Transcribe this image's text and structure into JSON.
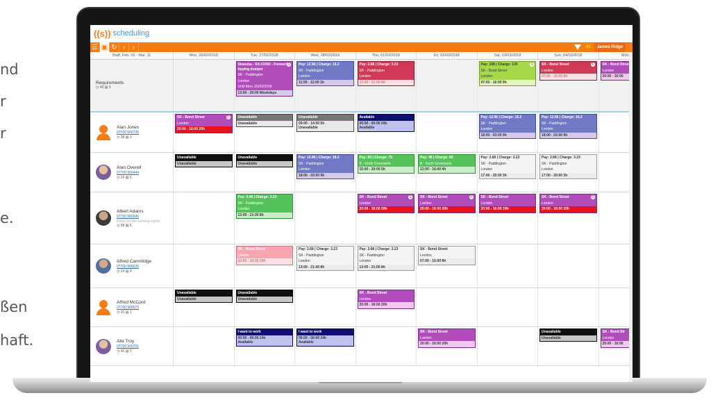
{
  "background_text": [
    "nd",
    "r",
    "r",
    "e.",
    "ßen",
    "haft."
  ],
  "app": {
    "logo_mark": "((s))",
    "logo_text": "scheduling"
  },
  "toolbar": {
    "buttons": [
      "☰",
      "💾",
      "↻",
      "‹",
      "›"
    ],
    "count": "-43",
    "user": "James Ridge"
  },
  "header": {
    "range_label": "Staff, Feb. 26 - Mar. 11",
    "days": [
      "Mon, 26/02/2018",
      "Tue, 27/02/2018",
      "Wed, 28/02/2018",
      "Thu, 01/03/2018",
      "Fri, 02/03/2018",
      "Sat, 03/03/2018",
      "Sun, 04/03/2018",
      "Mon, 05/"
    ]
  },
  "requirements": {
    "title": "Requirements",
    "stats": "◷ 46  ▤ 5",
    "cards": [
      {
        "day": 1,
        "color": "magenta",
        "head": "Skanska - SK-01992 - Forward tipping dumper",
        "body": "SK - Paddington\nLondon\nUntil Mon, 05/03/2018",
        "foot": "13:00 - 20:00 Weekdays",
        "sub": "lav",
        "badge": "1"
      },
      {
        "day": 2,
        "color": "blue",
        "head": "Pay: 12.96 | Charge: 16.2",
        "body": "SK - Paddington\nLondon",
        "foot": "11:00 - 12:00 1h",
        "sub": "lav"
      },
      {
        "day": 3,
        "color": "red",
        "head": "Pay: 2.68 | Charge: 3.23",
        "body": "SK - Paddington\nLondon",
        "foot": "13:00 - 21:00 8h",
        "sub": "pinklt2"
      },
      {
        "day": 5,
        "color": "lime",
        "head": "Pay: 108 | Charge: 135",
        "body": "SK - Bond Street\nLondon",
        "foot": "07:00 - 16:00 9h",
        "sub": "lime",
        "badge": "1"
      },
      {
        "day": 6,
        "color": "red",
        "head": "SK - Bond Street",
        "body": "London",
        "foot": "07:00 - 15:00 8h",
        "sub": "pinklt2",
        "badge": "1"
      },
      {
        "day": 7,
        "color": "magenta",
        "head": "SK - Bond Street",
        "body": "London",
        "foot": "20:00 - 16:00",
        "sub": "mag"
      }
    ]
  },
  "staff": [
    {
      "name": "Alan Jones",
      "phone": "07700 900735",
      "stats": "◷ 38  ▤ 3",
      "avatar": "orange",
      "cards": [
        {
          "day": 0,
          "color": "magenta",
          "head": "SK - Bond Street",
          "body": "London",
          "foot": "20:00 - 16:00 20h",
          "sub": "red",
          "badge": "2"
        },
        {
          "day": 1,
          "color": "gray",
          "head": "Unavailable",
          "body": "",
          "foot": "Unavailable",
          "sub": "light"
        },
        {
          "day": 2,
          "color": "gray",
          "head": "Unavailable",
          "body": "",
          "foot": "09:00 - 14:00 5h\nUnavailable",
          "sub": "light"
        },
        {
          "day": 3,
          "color": "navy",
          "head": "Available",
          "body": "",
          "foot": "00:00 - 00:00 24h\nAvailable",
          "sub": "navy"
        },
        {
          "day": 5,
          "color": "blue",
          "head": "Pay: 12.96 | Charge: 16.2",
          "body": "SK - Paddington\nLondon",
          "foot": "18:00 - 03:00 9h",
          "sub": "lav"
        },
        {
          "day": 6,
          "color": "blue",
          "head": "Pay: 12.96 | Charge: 16.2",
          "body": "SK - Paddington\nLondon",
          "foot": "18:00 - 03:00 9h",
          "sub": "lav"
        }
      ]
    },
    {
      "name": "Alan Overell",
      "phone": "07700 900444",
      "stats": "◷ 24  ▤ 5",
      "avatar": "photo2",
      "cards": [
        {
          "day": 0,
          "color": "black",
          "head": "Unavailable",
          "body": "",
          "foot": "Unavailable",
          "sub": "gray"
        },
        {
          "day": 1,
          "color": "black",
          "head": "Unavailable",
          "body": "",
          "foot": "Unavailable",
          "sub": "gray"
        },
        {
          "day": 2,
          "color": "blue",
          "head": "Pay: 12.96 | Charge: 16.2",
          "body": "SK - Paddington\nLondon",
          "foot": "18:00 - 03:00 9h",
          "sub": "lav"
        },
        {
          "day": 3,
          "color": "green",
          "head": "Pay: 60 | Charge: 75",
          "body": "B - North Greenwich",
          "foot": "15:00 - 20:00 5h",
          "sub": "green"
        },
        {
          "day": 4,
          "color": "green",
          "head": "Pay: 48 | Charge: 60",
          "body": "B - North Greenwich",
          "foot": "12:00 - 16:00 4h",
          "sub": "green"
        },
        {
          "day": 5,
          "color": "white",
          "head": "Pay: 2.68 | Charge: 3.23",
          "body": "SK - Paddington\nLondon",
          "foot": "17:00 - 20:00 3h",
          "sub": "lgray"
        },
        {
          "day": 6,
          "color": "white",
          "head": "Pay: 2.68 | Charge: 3.23",
          "body": "SK - Paddington\nLondon",
          "foot": "17:00 - 20:00 3h",
          "sub": "lgray"
        }
      ]
    },
    {
      "name": "Albert Adams",
      "phone": "07700 900346",
      "note": "Does not like working nights",
      "stats": "◷ 88  ▤ 5",
      "avatar": "photo",
      "cards": [
        {
          "day": 1,
          "color": "green",
          "head": "Pay: 2.68 | Charge: 3.23",
          "body": "SK - Paddington\nLondon",
          "foot": "13:00 - 21:00 8h",
          "sub": "green"
        },
        {
          "day": 3,
          "color": "magenta",
          "head": "SK - Bond Street",
          "body": "London",
          "foot": "20:00 - 16:00 20h",
          "sub": "red",
          "badge": "1"
        },
        {
          "day": 4,
          "color": "magenta",
          "head": "SK - Bond Street",
          "body": "London",
          "foot": "20:00 - 16:00 20h",
          "sub": "red",
          "badge": "2"
        },
        {
          "day": 5,
          "color": "magenta",
          "head": "SK - Bond Street",
          "body": "London",
          "foot": "20:00 - 16:00 20h",
          "sub": "red"
        },
        {
          "day": 6,
          "color": "magenta",
          "head": "SK - Bond Street",
          "body": "London",
          "foot": "20:00 - 16:00 20h",
          "sub": "red",
          "badge": "3"
        }
      ]
    },
    {
      "name": "Alfred Cammidge",
      "phone": "07700 900635",
      "stats": "◷ 24  ▤ 4",
      "avatar": "photo3",
      "cards": [
        {
          "day": 1,
          "color": "pink",
          "head": "SK - Bond Street",
          "body": "London",
          "foot": "20:00 - 16:00 20h",
          "sub": "pinklt"
        },
        {
          "day": 2,
          "color": "white",
          "head": "Pay: 2.68 | Charge: 3.23",
          "body": "SK - Paddington\nLondon",
          "foot": "13:00 - 21:00 8h",
          "sub": "lgray"
        },
        {
          "day": 3,
          "color": "white",
          "head": "Pay: 2.68 | Charge: 3.23",
          "body": "SK - Paddington\nLondon",
          "foot": "13:00 - 21:00 8h",
          "sub": "lgray"
        },
        {
          "day": 4,
          "color": "white",
          "head": "SK - Bond Street",
          "body": "London",
          "foot": "07:00 - 15:00 8h",
          "sub": "lgray"
        }
      ]
    },
    {
      "name": "Alfred McCord",
      "phone": "07700 900573",
      "stats": "◷ 20  ▤ 1",
      "avatar": "orange",
      "cards": [
        {
          "day": 0,
          "color": "black",
          "head": "Unavailable",
          "body": "",
          "foot": "Unavailable",
          "sub": "gray"
        },
        {
          "day": 1,
          "color": "black",
          "head": "Unavailable",
          "body": "",
          "foot": "Unavailable",
          "sub": "gray"
        },
        {
          "day": 3,
          "color": "magenta",
          "head": "SK - Bond Street",
          "body": "London",
          "foot": "20:00 - 16:00 20h",
          "sub": "mag"
        }
      ]
    },
    {
      "name": "Alie Troy",
      "phone": "07700 900701",
      "stats": "◷ 40  ▤ 2",
      "avatar": "photo2",
      "cards": [
        {
          "day": 1,
          "color": "navy",
          "head": "I want to work",
          "body": "",
          "foot": "00:00 - 00:00 24h\nAvailable",
          "sub": "navy"
        },
        {
          "day": 2,
          "color": "navy",
          "head": "I want to work",
          "body": "",
          "foot": "00:00 - 00:00 24h\nAvailable",
          "sub": "navy"
        },
        {
          "day": 4,
          "color": "magenta",
          "head": "SK - Bond Street",
          "body": "London",
          "foot": "20:00 - 16:00 20h",
          "sub": "mag"
        },
        {
          "day": 6,
          "color": "black",
          "head": "Unavailable",
          "body": "",
          "foot": "Unavailable",
          "sub": "gray"
        },
        {
          "day": 7,
          "color": "magenta",
          "head": "SK - Bond Str",
          "body": "London",
          "foot": "20:00 - 16:00",
          "sub": "mag"
        }
      ]
    }
  ]
}
